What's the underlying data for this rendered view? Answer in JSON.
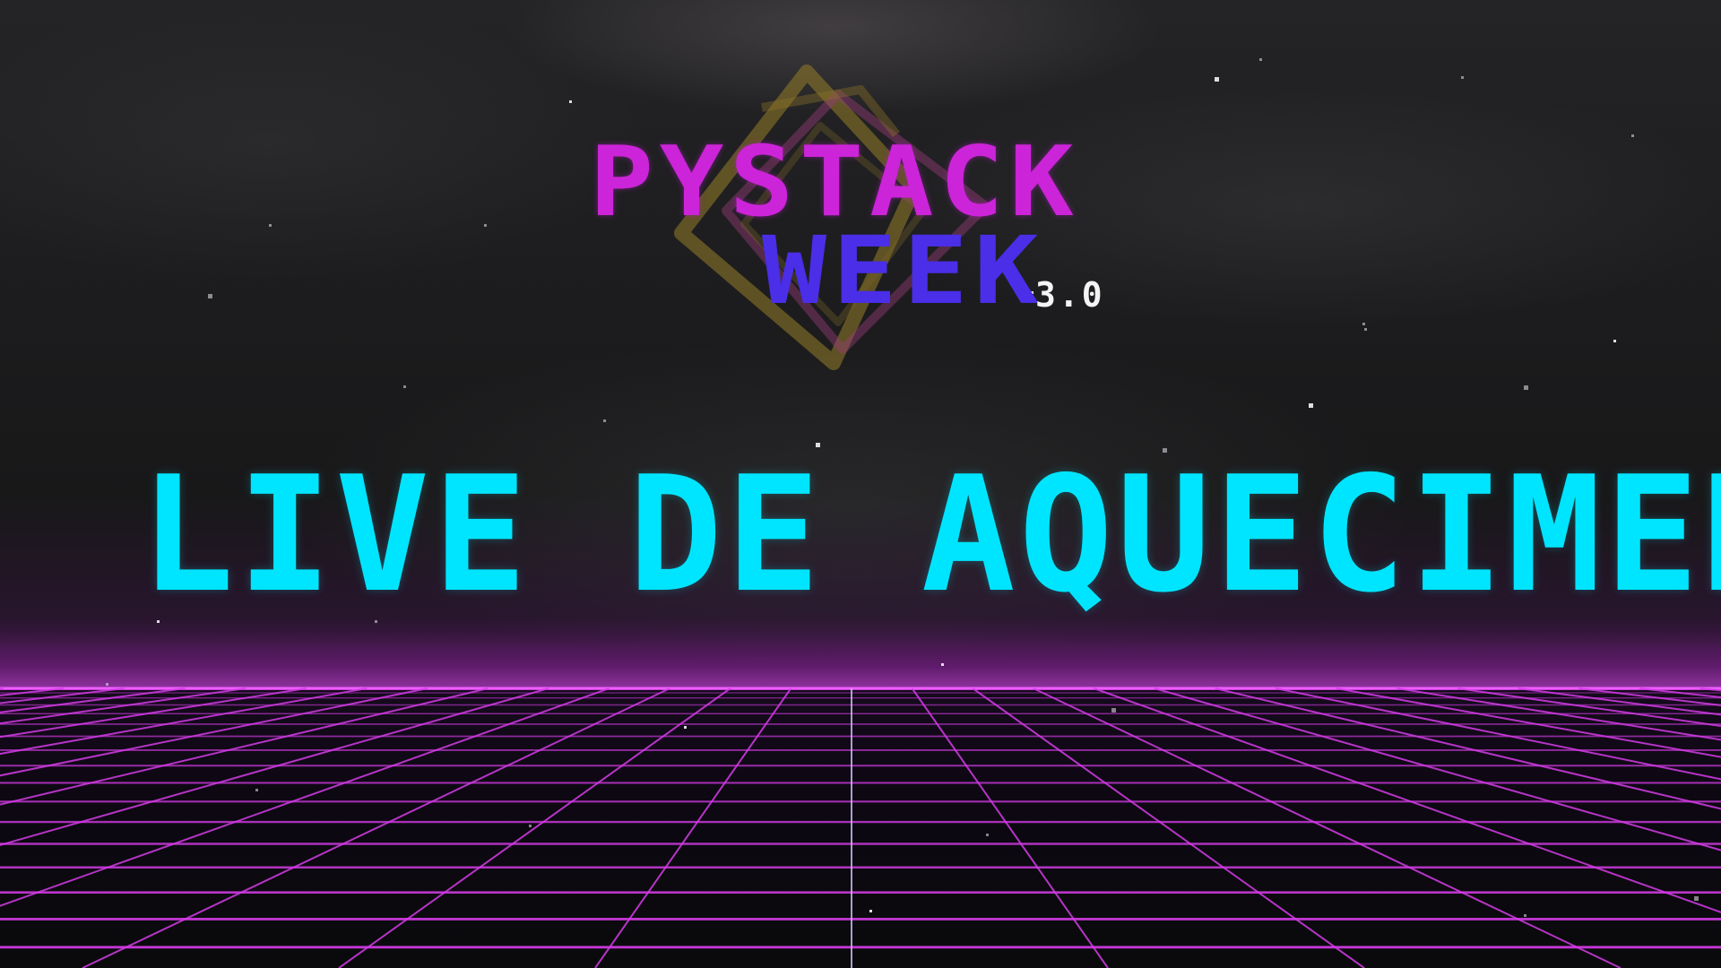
{
  "logo": {
    "line1": "PYSTACK",
    "line2": "WEEK",
    "version": "3.0"
  },
  "headline": "LIVE DE AQUECIMENTO",
  "colors": {
    "line1": "#cc24d8",
    "line2": "#4a2ee8",
    "headline": "#00e5ff",
    "grid": "#d43ce6",
    "horizon": "#f060ff"
  },
  "icons": {
    "emblem": "diamond-emblem-icon"
  }
}
